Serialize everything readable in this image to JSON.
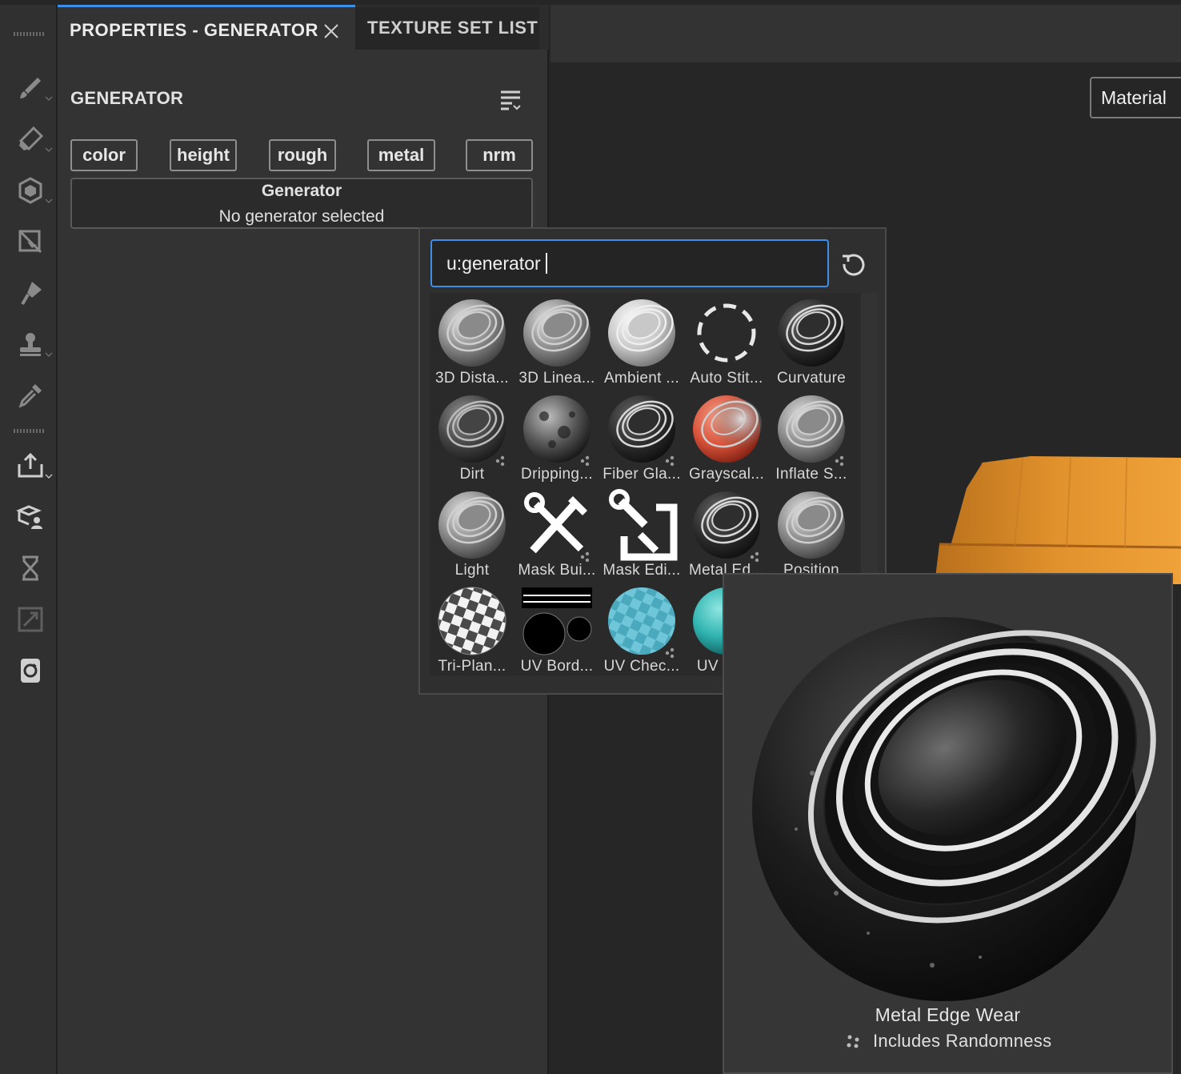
{
  "panel": {
    "active_tab": "PROPERTIES - GENERATOR",
    "inactive_tab": "TEXTURE SET LIST",
    "section_title": "GENERATOR",
    "channels": [
      "color",
      "height",
      "rough",
      "metal",
      "nrm"
    ],
    "generator_box": {
      "title": "Generator",
      "status": "No generator selected"
    }
  },
  "viewport": {
    "material_button": "Material"
  },
  "popup": {
    "search_value": "u:generator",
    "items": [
      {
        "label": "3D Dista...",
        "icon": "chrome-sphere"
      },
      {
        "label": "3D Linea...",
        "icon": "chrome-sphere"
      },
      {
        "label": "Ambient ...",
        "icon": "chrome-sphere-bright"
      },
      {
        "label": "Auto Stit...",
        "icon": "dashed-circle"
      },
      {
        "label": "Curvature",
        "icon": "dark-ringed-sphere"
      },
      {
        "label": "Dirt",
        "icon": "dirt-sphere",
        "random": true
      },
      {
        "label": "Dripping...",
        "icon": "dripping-sphere",
        "random": true
      },
      {
        "label": "Fiber Gla...",
        "icon": "dark-ringed-sphere",
        "random": true
      },
      {
        "label": "Grayscal...",
        "icon": "red-sphere",
        "random": false
      },
      {
        "label": "Inflate S...",
        "icon": "chrome-sphere",
        "random": true
      },
      {
        "label": "Light",
        "icon": "chrome-sphere"
      },
      {
        "label": "Mask Bui...",
        "icon": "wrench-pencil-icon",
        "random": true
      },
      {
        "label": "Mask Edi...",
        "icon": "wrench-anchor-icon"
      },
      {
        "label": "Metal Ed...",
        "icon": "dark-ringed-sphere",
        "random": true
      },
      {
        "label": "Position",
        "icon": "chrome-sphere"
      },
      {
        "label": "Tri-Plan...",
        "icon": "checker-sphere"
      },
      {
        "label": "UV Bord...",
        "icon": "uv-border-icon"
      },
      {
        "label": "UV Chec...",
        "icon": "uv-checker-sphere",
        "random": true
      },
      {
        "label": "UV Ra...",
        "icon": "teal-red-sphere"
      }
    ]
  },
  "preview": {
    "name": "Metal Edge Wear",
    "note": "Includes Randomness"
  },
  "colors": {
    "accent": "#3d8ee6",
    "panel": "#333333",
    "viewport": "#262626",
    "mesh": "#e8962e"
  }
}
